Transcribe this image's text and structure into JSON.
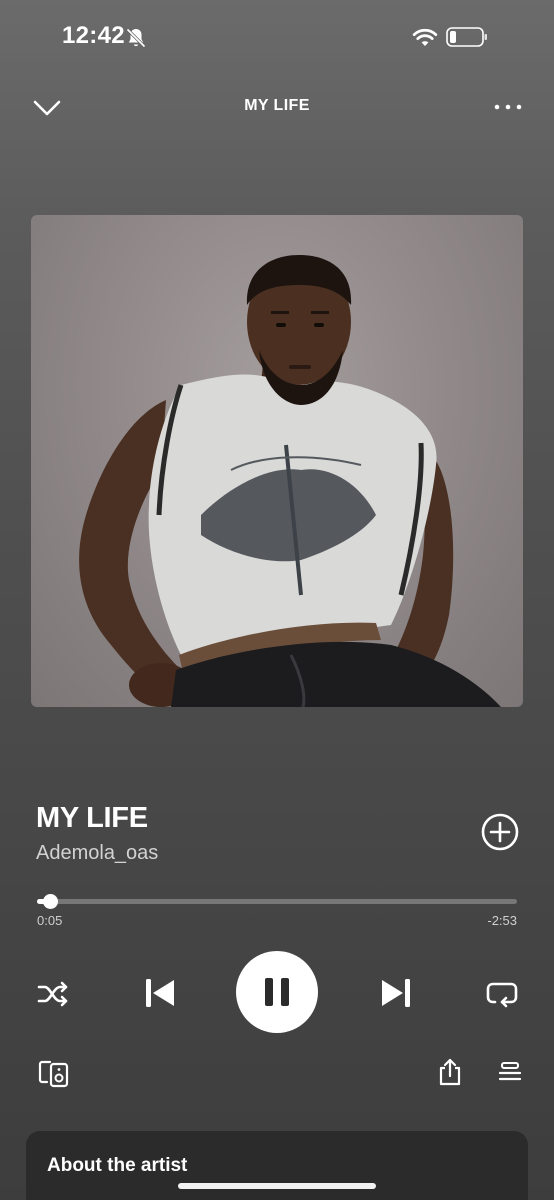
{
  "status_bar": {
    "time": "12:42",
    "icons": [
      "bell-slash-icon",
      "wifi-icon",
      "battery-icon"
    ]
  },
  "header": {
    "title": "MY LIFE",
    "left_icon": "chevron-down-icon",
    "right_icon": "more-horizontal-icon"
  },
  "track": {
    "title": "MY LIFE",
    "artist": "Ademola_oas"
  },
  "progress": {
    "elapsed": "0:05",
    "remaining": "-2:53",
    "fraction": 0.028
  },
  "controls": {
    "shuffle_icon": "shuffle-icon",
    "previous_icon": "skip-previous-icon",
    "play_pause_icon": "pause-icon",
    "next_icon": "skip-next-icon",
    "repeat_icon": "repeat-icon",
    "add_icon": "add-circle-icon",
    "devices_icon": "connect-device-icon",
    "share_icon": "share-icon",
    "queue_icon": "queue-icon"
  },
  "about": {
    "title": "About the artist"
  },
  "colors": {
    "background_top": "#6b6b6b",
    "background_bottom": "#3d3d3d",
    "card": "#2b2b2b",
    "accent": "#ffffff"
  }
}
